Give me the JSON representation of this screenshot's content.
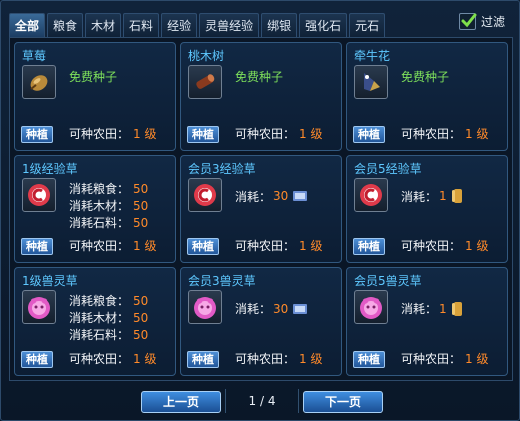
{
  "tabs": [
    "全部",
    "粮食",
    "木材",
    "石料",
    "经验",
    "灵兽经验",
    "绑银",
    "强化石",
    "元石"
  ],
  "filter_label": "过滤",
  "plant_label": "种植",
  "field_label": "可种农田：",
  "cost_label": "消耗：",
  "cards": [
    {
      "title": "草莓",
      "free": "免费种子",
      "level": "1 级",
      "icon": "strawberry-seed-icon"
    },
    {
      "title": "桃木树",
      "free": "免费种子",
      "level": "1 级",
      "icon": "peach-wood-icon"
    },
    {
      "title": "牵牛花",
      "free": "免费种子",
      "level": "1 级",
      "icon": "morning-glory-icon"
    },
    {
      "title": "1级经验草",
      "costs": [
        {
          "label": "消耗粮食：",
          "value": "50"
        },
        {
          "label": "消耗木材：",
          "value": "50"
        },
        {
          "label": "消耗石料：",
          "value": "50"
        }
      ],
      "level": "1 级",
      "icon": "red-exp-grass-icon"
    },
    {
      "title": "会员3经验草",
      "cost_value": "30",
      "cost_icon": "ticket-icon",
      "level": "1 级",
      "icon": "red-exp-grass-icon"
    },
    {
      "title": "会员5经验草",
      "cost_value": "1",
      "cost_icon": "scroll-icon",
      "level": "1 级",
      "icon": "red-exp-grass-icon"
    },
    {
      "title": "1级兽灵草",
      "costs": [
        {
          "label": "消耗粮食：",
          "value": "50"
        },
        {
          "label": "消耗木材：",
          "value": "50"
        },
        {
          "label": "消耗石料：",
          "value": "50"
        }
      ],
      "level": "1 级",
      "icon": "pink-beast-grass-icon"
    },
    {
      "title": "会员3兽灵草",
      "cost_value": "30",
      "cost_icon": "ticket-icon",
      "level": "1 级",
      "icon": "pink-beast-grass-icon"
    },
    {
      "title": "会员5兽灵草",
      "cost_value": "1",
      "cost_icon": "scroll-icon",
      "level": "1 级",
      "icon": "pink-beast-grass-icon"
    }
  ],
  "pager": {
    "prev": "上一页",
    "next": "下一页",
    "info": "1 / 4"
  },
  "colors": {
    "title": "#5ec8ff",
    "free": "#7ee05b",
    "number": "#ff8a2a",
    "button": "#22569a"
  }
}
